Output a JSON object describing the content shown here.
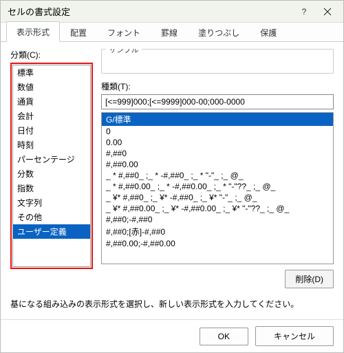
{
  "window": {
    "title": "セルの書式設定"
  },
  "tabs": {
    "items": [
      "表示形式",
      "配置",
      "フォント",
      "罫線",
      "塗りつぶし",
      "保護"
    ],
    "active_index": 0
  },
  "category": {
    "label": "分類(C):",
    "items": [
      "標準",
      "数値",
      "通貨",
      "会計",
      "日付",
      "時刻",
      "パーセンテージ",
      "分数",
      "指数",
      "文字列",
      "その他",
      "ユーザー定義"
    ],
    "selected_index": 11
  },
  "sample": {
    "label": "サンプル"
  },
  "type": {
    "label": "種類(T):",
    "input_value": "[<=999]000;[<=9999]000-00;000-0000",
    "items": [
      "G/標準",
      "0",
      "0.00",
      "#,##0",
      "#,##0.00",
      "_ * #,##0_ ;_ * -#,##0_ ;_ * \"-\"_ ;_ @_ ",
      "_ * #,##0.00_ ;_ * -#,##0.00_ ;_ * \"-\"??_ ;_ @_ ",
      "_ ¥* #,##0_ ;_ ¥* -#,##0_ ;_ ¥* \"-\"_ ;_ @_ ",
      "_ ¥* #,##0.00_ ;_ ¥* -#,##0.00_ ;_ ¥* \"-\"??_ ;_ @_ ",
      "#,##0;-#,##0",
      "#,##0;[赤]-#,##0",
      "#,##0.00;-#,##0.00"
    ],
    "selected_index": 0
  },
  "buttons": {
    "delete": "削除(D)",
    "ok": "OK",
    "cancel": "キャンセル"
  },
  "hint": "基になる組み込みの表示形式を選択し、新しい表示形式を入力してください。"
}
